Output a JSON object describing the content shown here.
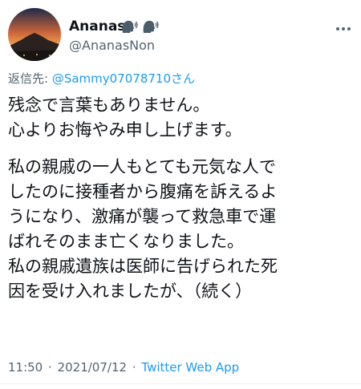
{
  "tweet": {
    "author": {
      "display_name": "Ananas",
      "name_emojis": [
        "speaking-head-icon",
        "speaking-head-icon"
      ],
      "handle": "@AnanasNon",
      "avatar": "sunset-mountain-avatar"
    },
    "more_icon": "more-dots-icon",
    "reply_to": {
      "prefix": "返信先: ",
      "handle": "@Sammy07078710さん"
    },
    "body": {
      "paragraph1": [
        "残念で言葉もありません。",
        "心よりお悔やみ申し上げます。"
      ],
      "paragraph2": [
        "私の親戚の一人もとても元気な人で",
        "したのに接種者から腹痛を訴えるよ",
        "うになり、激痛が襲って救急車で運",
        "ばれそのまま亡くなりました。",
        "私の親戚遺族は医師に告げられた死",
        "因を受け入れましたが、（続く）"
      ]
    },
    "meta": {
      "time": "11:50",
      "separator1": "·",
      "date": "2021/07/12",
      "separator2": "·",
      "source": "Twitter Web App"
    }
  },
  "colors": {
    "text": "#0f1419",
    "secondary": "#536471",
    "link": "#1d9bf0"
  }
}
